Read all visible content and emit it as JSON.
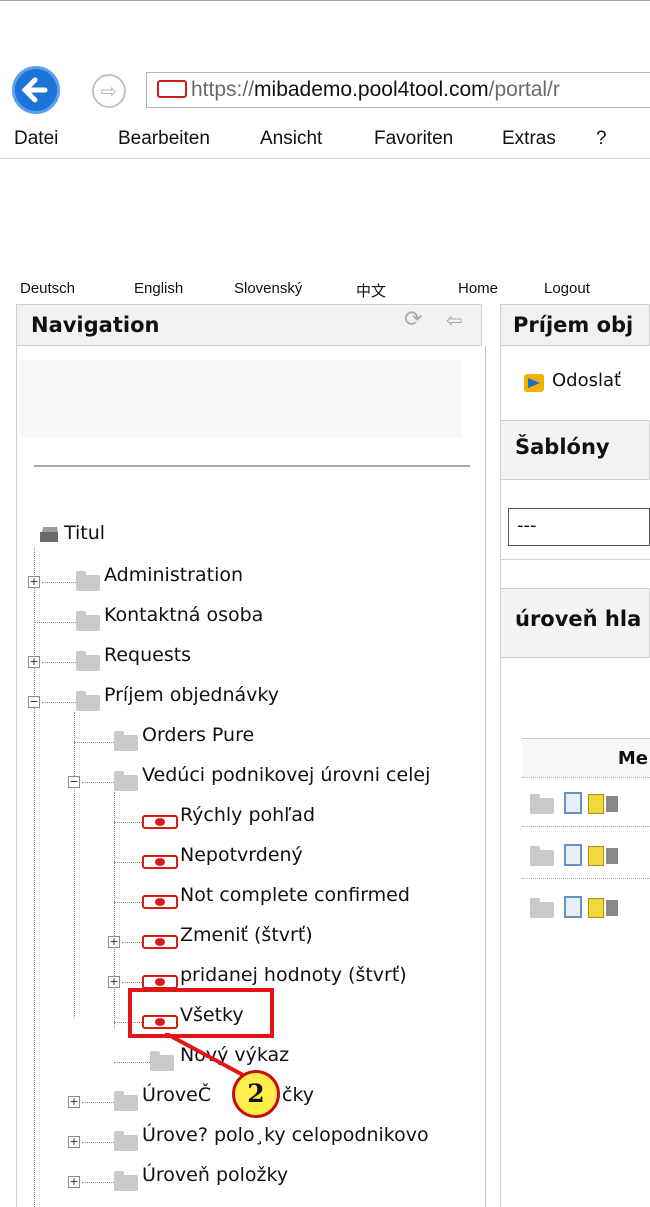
{
  "browser": {
    "url_prefix": "https://",
    "url_domain": "mibademo.pool4tool.com",
    "url_path": "/portal/r",
    "menu": [
      "Datei",
      "Bearbeiten",
      "Ansicht",
      "Favoriten",
      "Extras",
      "?"
    ]
  },
  "lang_links": [
    "Deutsch",
    "English",
    "Slovenský",
    "中文",
    "Home",
    "Logout"
  ],
  "navigation": {
    "title": "Navigation",
    "root": "Titul",
    "items": [
      "Administration",
      "Kontaktná osoba",
      "Requests",
      "Príjem objednávky",
      "Orders Pure",
      "Vedúci podnikovej úrovni celej",
      "Rýchly pohľad",
      "Nepotvrdený",
      "Not complete confirmed",
      "Zmeniť (štvrť)",
      "pridanej hodnoty (štvrť)",
      "Všetky",
      "Nový výkaz",
      "ÚroveČ",
      "čky",
      "Úrove? polo¸ky celopodnikovo",
      "Úroveň položky"
    ]
  },
  "right_panel": {
    "title": "Príjem obj",
    "send_label": "Odoslať",
    "templates_title": "Šablóny",
    "templates_value": "---",
    "level_title": "úroveň hla",
    "col_header": "Me"
  },
  "callout": {
    "number": "2"
  },
  "colors": {
    "accent_red": "#e41515",
    "callout_yellow": "#ffee4c",
    "back_blue": "#1b74d6"
  }
}
